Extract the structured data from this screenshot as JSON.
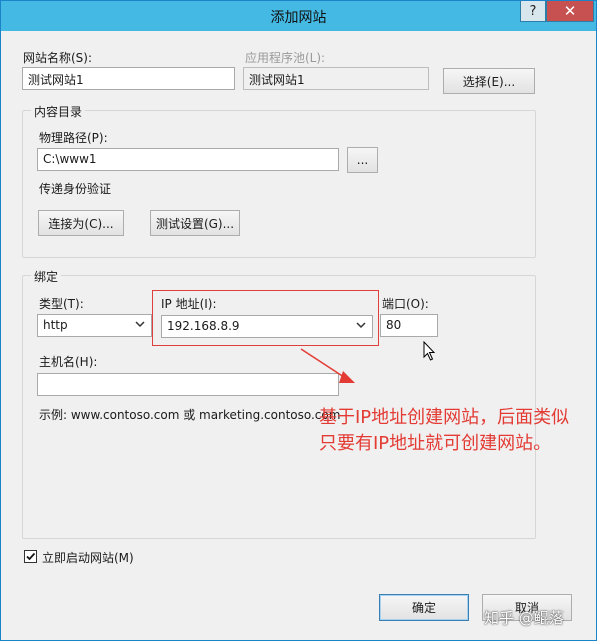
{
  "window": {
    "title": "添加网站",
    "help_label": "?",
    "close_label": "✕"
  },
  "site_name": {
    "label": "网站名称(S):",
    "value": "测试网站1"
  },
  "app_pool": {
    "label": "应用程序池(L):",
    "value": "测试网站1",
    "select_button": "选择(E)..."
  },
  "content_directory": {
    "group_title": "内容目录",
    "physical_path_label": "物理路径(P):",
    "physical_path_value": "C:\\www1",
    "browse_button": "...",
    "pass_through_label": "传递身份验证",
    "connect_as_button": "连接为(C)...",
    "test_settings_button": "测试设置(G)..."
  },
  "binding": {
    "group_title": "绑定",
    "type_label": "类型(T):",
    "type_value": "http",
    "ip_label": "IP 地址(I):",
    "ip_value": "192.168.8.9",
    "port_label": "端口(O):",
    "port_value": "80",
    "hostname_label": "主机名(H):",
    "hostname_value": "",
    "example_text": "示例: www.contoso.com 或 marketing.contoso.com"
  },
  "annotation": {
    "line1": "基于IP地址创建网站，后面类似",
    "line2": "只要有IP地址就可创建网站。",
    "color": "#e33b34"
  },
  "start_immediately": {
    "label": "立即启动网站(M)",
    "checked": true
  },
  "footer": {
    "ok_button": "确定",
    "cancel_button": "取消"
  },
  "watermark": "知乎 @鲲落"
}
